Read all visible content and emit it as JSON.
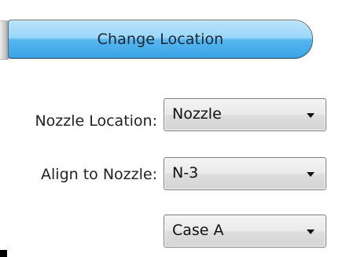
{
  "change_location_button": {
    "label": "Change Location"
  },
  "rows": [
    {
      "label": "Nozzle Location:",
      "value": "Nozzle"
    },
    {
      "label": "Align to Nozzle:",
      "value": "N-3"
    },
    {
      "label": "",
      "value": "Case A"
    }
  ],
  "colors": {
    "button_top": "#b9e4fb",
    "button_bottom": "#3aa4e8",
    "combo_border": "#7a7a7a",
    "text": "#222222"
  },
  "icons": {
    "dropdown": "triangle-down"
  }
}
